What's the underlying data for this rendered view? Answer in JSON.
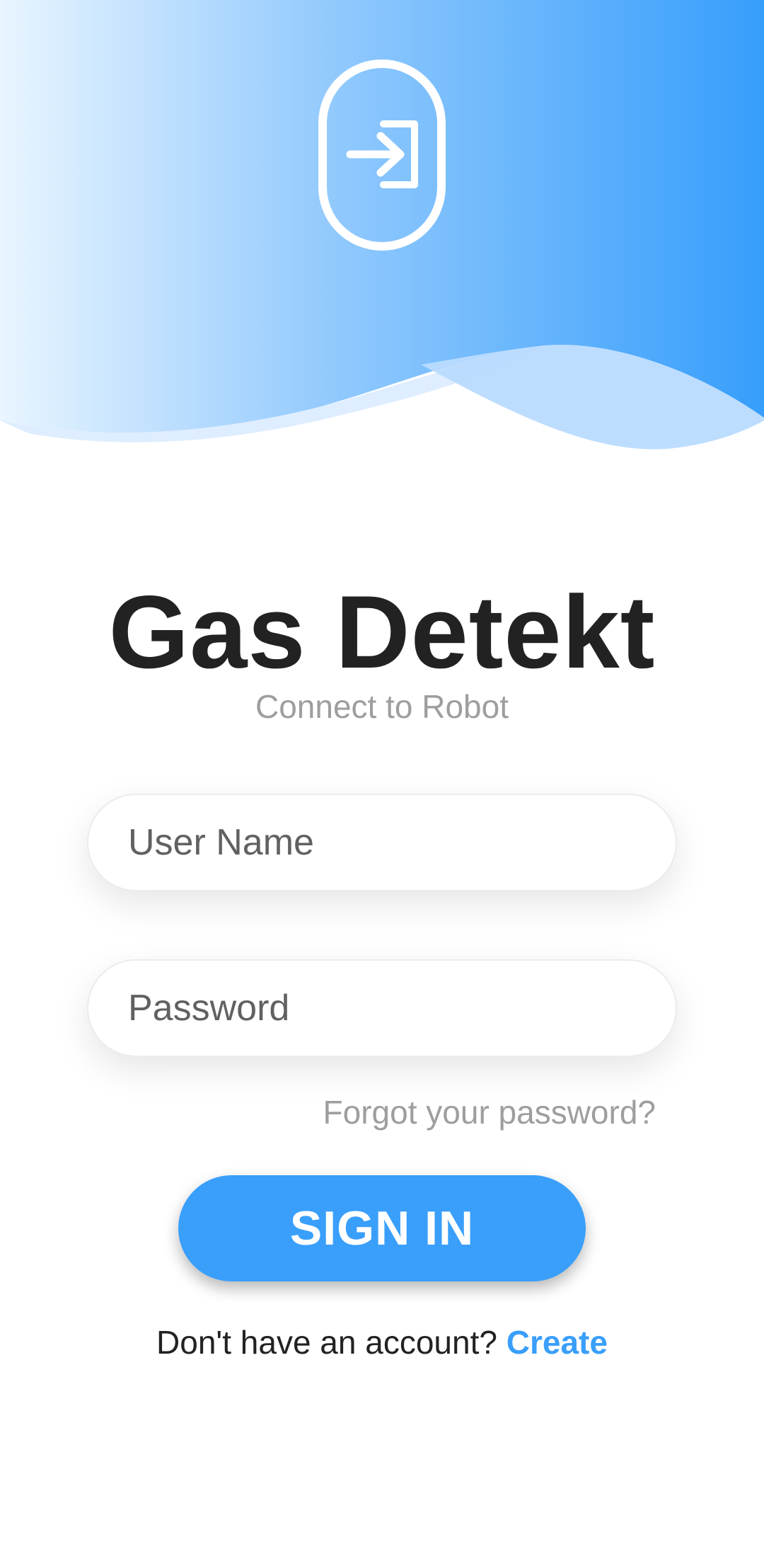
{
  "app": {
    "title": "Gas Detekt",
    "subtitle": "Connect to Robot"
  },
  "form": {
    "username_placeholder": "User Name",
    "password_placeholder": "Password",
    "forgot_label": "Forgot your password?",
    "signin_label": "SIGN IN"
  },
  "signup": {
    "prompt": "Don't have an account?",
    "link_label": "Create"
  },
  "icons": {
    "header": "login-icon"
  },
  "colors": {
    "accent": "#399ffb",
    "title": "#222222",
    "muted": "#9e9e9e"
  }
}
